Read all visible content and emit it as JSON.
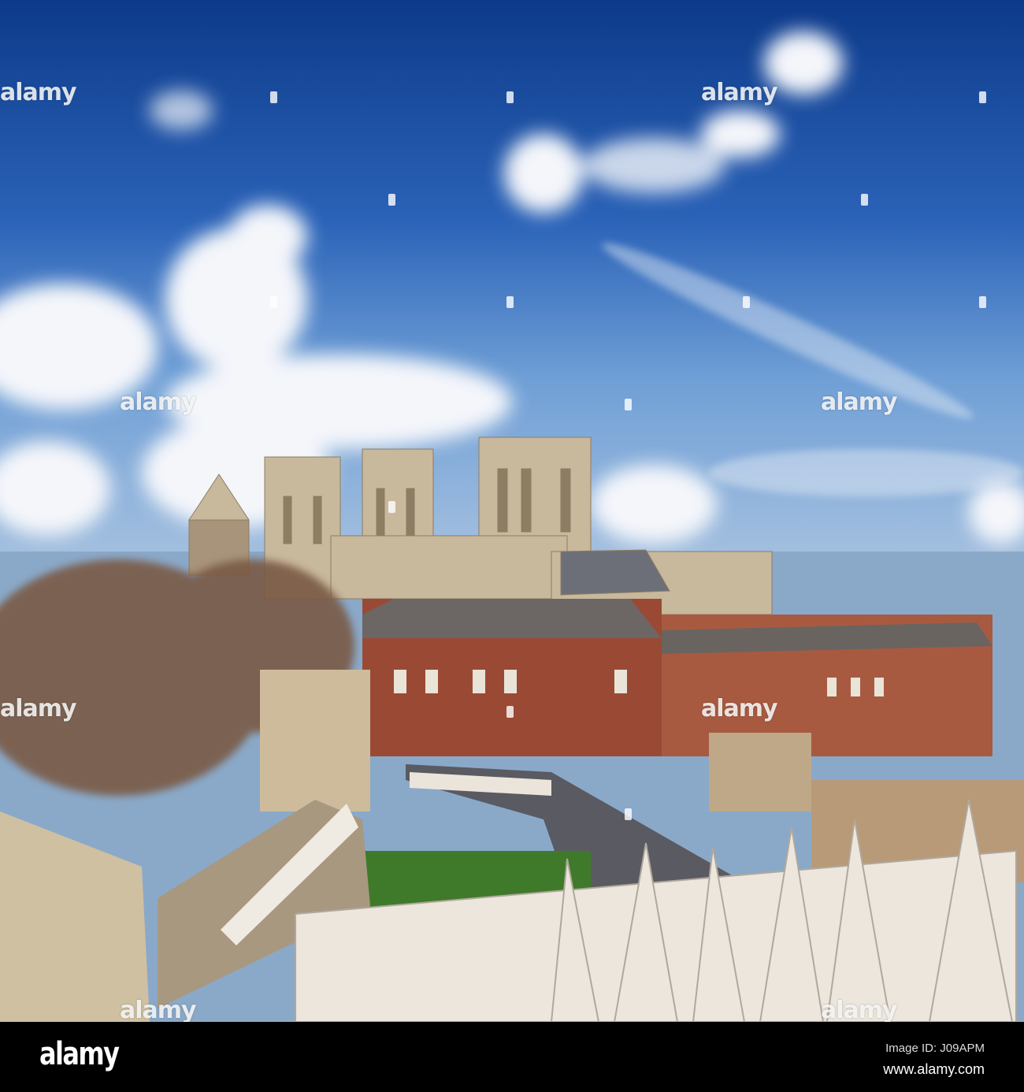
{
  "photo": {
    "subject": "York Minster skyline from the city walls",
    "colors": {
      "sky_top": "#0f3f8f",
      "sky_bottom": "#6f9fd6",
      "stone": "#c8b79a",
      "brick": "#9a4a34",
      "fence": "#ece6dc"
    }
  },
  "watermark": {
    "text": "alamy"
  },
  "footer": {
    "logo": "alamy",
    "image_id": "Image ID: J09APM",
    "website": "www.alamy.com"
  }
}
